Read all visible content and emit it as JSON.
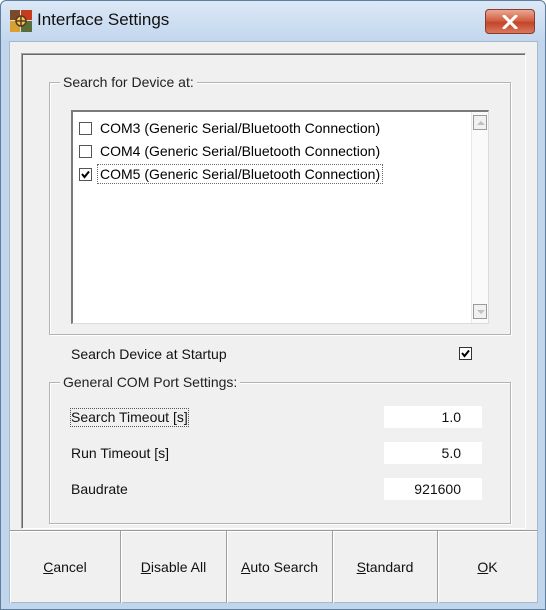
{
  "window": {
    "title": "Interface Settings",
    "app_icon": "app-logo-icon",
    "close_icon": "close-icon"
  },
  "search_group": {
    "legend": "Search for Device at:",
    "ports": [
      {
        "label": "COM3 (Generic Serial/Bluetooth Connection)",
        "checked": false
      },
      {
        "label": "COM4 (Generic Serial/Bluetooth Connection)",
        "checked": false
      },
      {
        "label": "COM5 (Generic Serial/Bluetooth Connection)",
        "checked": true
      }
    ]
  },
  "startup": {
    "label": "Search Device at Startup",
    "checked": true
  },
  "com_group": {
    "legend": "General COM Port Settings:",
    "search_timeout_label": "Search Timeout [s]",
    "search_timeout_value": "1.0",
    "run_timeout_label": "Run Timeout [s]",
    "run_timeout_value": "5.0",
    "baudrate_label": "Baudrate",
    "baudrate_value": "921600"
  },
  "buttons": {
    "cancel": {
      "access": "C",
      "rest": "ancel"
    },
    "disable_all": {
      "access": "D",
      "rest": "isable All"
    },
    "auto_search": {
      "access": "A",
      "rest": "uto Search"
    },
    "standard": {
      "access": "S",
      "rest": "tandard"
    },
    "ok": {
      "access": "O",
      "rest": "K"
    }
  },
  "colors": {
    "title_bar": "#c3d7ee",
    "close_button": "#c2452a",
    "dialog_face": "#f0f0f0"
  }
}
